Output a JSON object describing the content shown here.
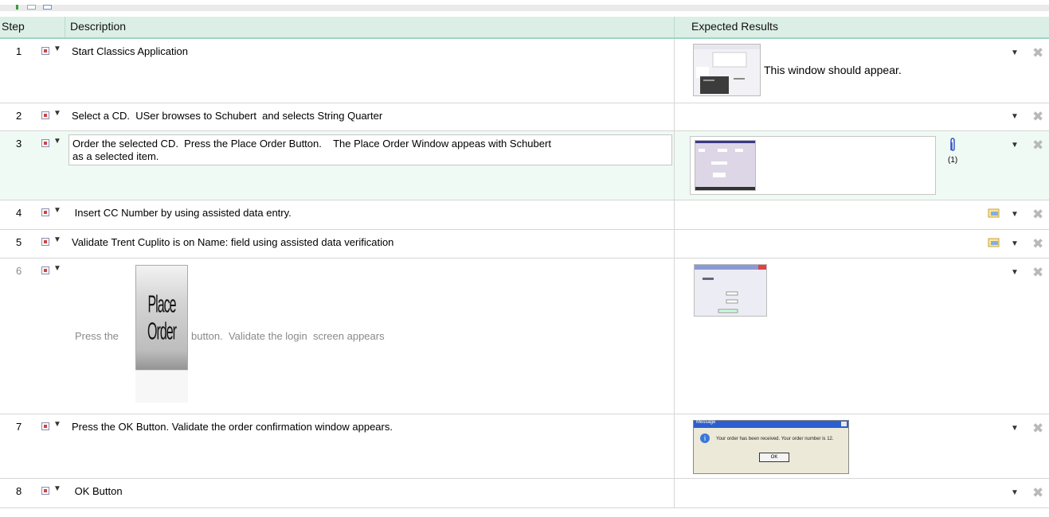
{
  "header": {
    "step": "Step",
    "description": "Description",
    "expected": "Expected Results"
  },
  "rows": [
    {
      "num": "1",
      "description": "Start Classics Application",
      "expected": "This window should appear."
    },
    {
      "num": "2",
      "description": "Select a CD.  USer browses to Schubert  and selects String Quarter",
      "expected": ""
    },
    {
      "num": "3",
      "description_line1": "Order the selected CD.  Press the Place Order Button.    The Place Order Window appeas with Schubert",
      "description_line2": "as a selected item.",
      "attachment_count": "(1)"
    },
    {
      "num": "4",
      "description": " Insert CC Number by using assisted data entry."
    },
    {
      "num": "5",
      "description": "Validate Trent Cuplito is on Name: field using assisted data verification"
    },
    {
      "num": "6",
      "desc_before": "Press the",
      "button_image_text": "Place Order",
      "desc_after": "button.  Validate the login  screen appears"
    },
    {
      "num": "7",
      "description": "Press the OK Button.  Validate the order confirmation window appears.",
      "msg_title": "Message",
      "msg_text": "Your order has been received. Your order number is 12.",
      "msg_ok": "OK"
    },
    {
      "num": "8",
      "description": " OK Button"
    }
  ],
  "colors": {
    "header_bg": "#dcefe7",
    "header_border": "#9fd5c2",
    "selected_row_bg": "#f0faf4",
    "delete_icon": "#b9b9b9"
  },
  "icons": [
    "step-type-icon",
    "dropdown-arrow-icon",
    "delete-x-icon",
    "paperclip-icon",
    "assisted-data-icon"
  ]
}
